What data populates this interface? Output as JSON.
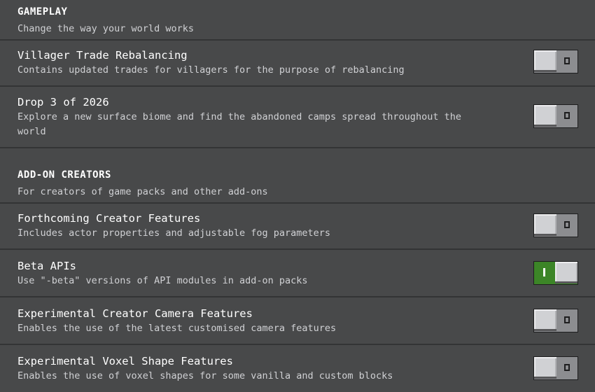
{
  "sections": [
    {
      "title": "GAMEPLAY",
      "description": "Change the way your world works",
      "items": [
        {
          "title": "Villager Trade Rebalancing",
          "description": "Contains updated trades for villagers for the purpose of rebalancing",
          "enabled": false,
          "toggle_glyph": "O"
        },
        {
          "title": "Drop 3 of 2026",
          "description": "Explore a new surface biome and find the abandoned camps spread throughout the world",
          "enabled": false,
          "toggle_glyph": "O"
        }
      ]
    },
    {
      "title": "ADD-ON CREATORS",
      "description": "For creators of game packs and other add-ons",
      "items": [
        {
          "title": "Forthcoming Creator Features",
          "description": "Includes actor properties and adjustable fog parameters",
          "enabled": false,
          "toggle_glyph": "O"
        },
        {
          "title": "Beta APIs",
          "description": "Use \"-beta\" versions of API modules in add-on packs",
          "enabled": true,
          "toggle_glyph": "I"
        },
        {
          "title": "Experimental Creator Camera Features",
          "description": "Enables the use of the latest customised camera features",
          "enabled": false,
          "toggle_glyph": "O"
        },
        {
          "title": "Experimental Voxel Shape Features",
          "description": "Enables the use of voxel shapes for some vanilla and custom blocks",
          "enabled": false,
          "toggle_glyph": "O"
        }
      ]
    }
  ],
  "colors": {
    "background": "#48494a",
    "divider": "#333435",
    "toggle_off": "#8c8d90",
    "toggle_on": "#3c8527",
    "knob": "#d0d1d4",
    "text_primary": "#ffffff",
    "text_secondary": "#d0d1d4"
  }
}
